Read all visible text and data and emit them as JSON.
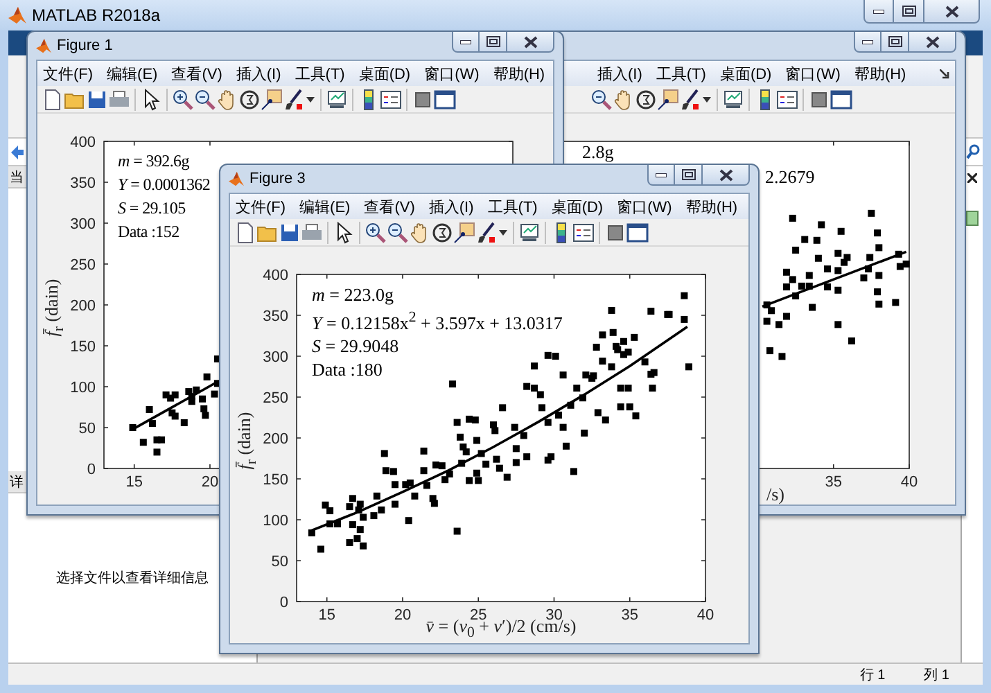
{
  "window": {
    "title": "MATLAB R2018a"
  },
  "left_panel": {
    "header": "当",
    "details_header": "详",
    "details_message": "选择文件以查看详细信息"
  },
  "figures": [
    {
      "title": "Figure 1",
      "menu": [
        "文件(F)",
        "编辑(E)",
        "查看(V)",
        "插入(I)",
        "工具(T)",
        "桌面(D)",
        "窗口(W)",
        "帮助(H)"
      ],
      "chart_data": {
        "type": "scatter",
        "ylabel": "*f̄*$_{r}$ (dain)",
        "xlim": [
          13,
          40
        ],
        "ylim": [
          0,
          400
        ],
        "xticks": [
          15,
          20
        ],
        "yticks": [
          0,
          50,
          100,
          150,
          200,
          250,
          300,
          350,
          400
        ],
        "annotations": [
          "*m* = 392.6g",
          "*Y* = 0.0001362",
          "*S* = 29.105",
          "Data :152"
        ],
        "series": [
          {
            "type": "scatter",
            "color": "#000000",
            "x": [
              14.9,
              15.6,
              16.0,
              16.2,
              16.5,
              16.8,
              16.5,
              17.1,
              17.7,
              17.4,
              17.5,
              17.7,
              18.3,
              18.6,
              18.8,
              19.1,
              18.8,
              19.5,
              19.6,
              19.7,
              19.8,
              20.3,
              20.5,
              20.5
            ],
            "values": [
              50,
              32,
              72,
              55,
              35,
              35,
              20,
              90,
              90,
              86,
              68,
              64,
              56,
              94,
              82,
              96,
              88,
              85,
              73,
              65,
              112,
              91,
              104,
              134
            ]
          },
          {
            "type": "line",
            "color": "#000000",
            "x": [
              14.9,
              20.5
            ],
            "values": [
              48,
              106
            ]
          }
        ]
      }
    },
    {
      "menu": [
        "插入(I)",
        "工具(T)",
        "桌面(D)",
        "窗口(W)",
        "帮助(H)"
      ],
      "chart_data": {
        "type": "scatter",
        "xlabel": "/s)",
        "xlim": [
          13,
          40
        ],
        "ylim": [
          0,
          400
        ],
        "xticks": [
          35,
          40
        ],
        "annotations": [
          "2.8g",
          "2.2679"
        ],
        "series": [
          {
            "type": "scatter",
            "color": "#000000",
            "x": [
              32.3,
              34.2,
              37.5,
              37.9,
              33.1,
              33.9,
              35.5,
              32.5,
              34.0,
              35.3,
              35.9,
              38.0,
              37.4,
              35.7,
              34.6,
              33.4,
              35.3,
              37.3,
              38.0,
              37.0,
              39.3,
              39.8,
              39.4,
              31.9,
              32.3,
              31.9,
              32.9,
              33.4,
              34.6,
              35.3,
              37.9,
              38.0,
              39.1,
              35.3,
              36.2,
              30.8,
              31.6,
              31.4,
              30.6,
              30.9,
              31.9,
              33.6,
              32.5,
              30.6
            ],
            "values": [
              306,
              298,
              312,
              288,
              280,
              279,
              290,
              267,
              257,
              263,
              258,
              270,
              258,
              252,
              244,
              236,
              242,
              244,
              236,
              233,
              262,
              250,
              247,
              240,
              231,
              222,
              223,
              223,
              222,
              218,
              216,
              201,
              203,
              176,
              156,
              144,
              137,
              176,
              180,
              193,
              186,
              197,
              211,
              200
            ]
          },
          {
            "type": "line",
            "color": "#000000",
            "x": [
              30.3,
              39.8
            ],
            "values": [
              198,
              265
            ]
          }
        ]
      }
    },
    {
      "title": "Figure 3",
      "menu": [
        "文件(F)",
        "编辑(E)",
        "查看(V)",
        "插入(I)",
        "工具(T)",
        "桌面(D)",
        "窗口(W)",
        "帮助(H)"
      ],
      "chart_data": {
        "type": "scatter",
        "xlabel": "*v̄* = (*v*$_{0}$ + *v*′)/2 (cm/s)",
        "ylabel": "*f̄*$_{r}$ (dain)",
        "xlim": [
          13,
          40
        ],
        "ylim": [
          0,
          400
        ],
        "xticks": [
          15,
          20,
          25,
          30,
          35,
          40
        ],
        "yticks": [
          0,
          50,
          100,
          150,
          200,
          250,
          300,
          350,
          400
        ],
        "annotations": [
          "*m* = 223.0g",
          "*Y* = 0.12158x$^{2}$ + 3.597x + 13.0317",
          "*S* = 29.9048",
          "Data :180"
        ],
        "series": [
          {
            "type": "scatter",
            "color": "#000000",
            "x": [
              14.0,
              14.6,
              14.9,
              15.2,
              15.2,
              15.7,
              16.5,
              16.7,
              16.5,
              16.7,
              17.0,
              17.1,
              17.2,
              17.4,
              17.2,
              17.4,
              18.1,
              18.3,
              18.6,
              18.8,
              18.9,
              19.4,
              19.5,
              19.5,
              20.2,
              20.4,
              20.5,
              20.8,
              21.4,
              21.4,
              21.6,
              22.0,
              22.1,
              22.2,
              22.6,
              22.8,
              23.1,
              23.3,
              23.6,
              23.6,
              23.8,
              23.9,
              24.0,
              24.2,
              24.4,
              24.4,
              24.8,
              24.9,
              24.9,
              25.0,
              25.2,
              25.5,
              26.0,
              26.1,
              26.2,
              26.4,
              26.6,
              26.9,
              27.4,
              27.5,
              27.5,
              28.0,
              28.2,
              28.2,
              28.7,
              29.1,
              29.2,
              29.6,
              29.6,
              29.8,
              30.3,
              30.6,
              30.6,
              30.8,
              31.1,
              31.3,
              31.5,
              31.9,
              32.0,
              32.1,
              32.5,
              32.9,
              33.4,
              34.4,
              34.4,
              34.9,
              35.0,
              35.4,
              36.4,
              36.5,
              28.7,
              29.6,
              30.1,
              32.6,
              32.8,
              33.2,
              33.8,
              33.2,
              33.9,
              34.1,
              34.6,
              34.2,
              33.8,
              34.6,
              35.3,
              34.9,
              36.0,
              36.4,
              36.6,
              37.5,
              37.6,
              38.6,
              38.6,
              38.9
            ],
            "values": [
              84,
              64,
              118,
              111,
              95,
              95,
              116,
              126,
              72,
              94,
              77,
              112,
              119,
              68,
              88,
              103,
              105,
              129,
              112,
              181,
              160,
              159,
              143,
              119,
              143,
              99,
              145,
              129,
              184,
              160,
              142,
              126,
              120,
              167,
              166,
              149,
              156,
              266,
              86,
              219,
              201,
              169,
              189,
              183,
              148,
              223,
              222,
              197,
              157,
              148,
              181,
              168,
              216,
              209,
              174,
              163,
              237,
              152,
              213,
              187,
              170,
              203,
              263,
              177,
              261,
              253,
              237,
              219,
              173,
              177,
              228,
              277,
              213,
              190,
              240,
              159,
              261,
              249,
              206,
              277,
              273,
              231,
              222,
              238,
              261,
              261,
              238,
              227,
              278,
              261,
              288,
              301,
              300,
              276,
              311,
              326,
              356,
              294,
              329,
              312,
              318,
              308,
              287,
              302,
              323,
              305,
              293,
              355,
              280,
              351,
              351,
              374,
              345,
              287
            ]
          },
          {
            "type": "line",
            "color": "#000000",
            "x": [
              14,
              17,
              20,
              23,
              26,
              29,
              32,
              35,
              38.8
            ],
            "values": [
              87,
              109,
              134,
              160,
              189,
              220,
              253,
              288,
              336
            ]
          }
        ]
      }
    }
  ],
  "status_bar": {
    "row": "行 1",
    "column": "列 1"
  }
}
